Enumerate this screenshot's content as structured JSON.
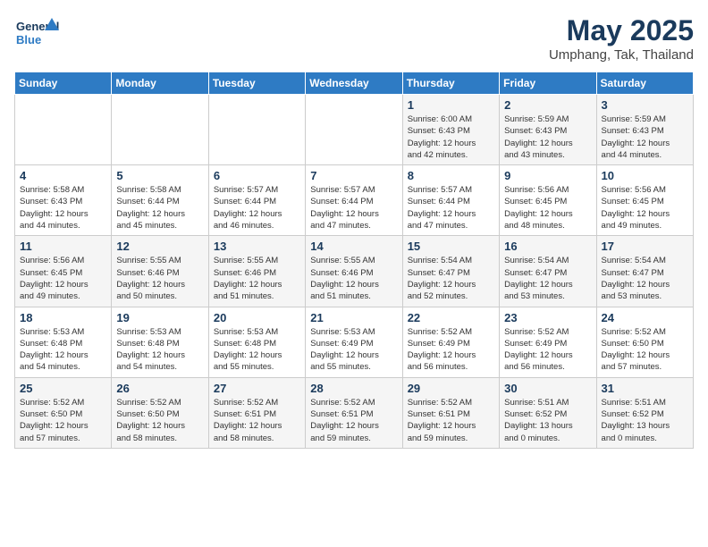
{
  "header": {
    "logo_line1": "General",
    "logo_line2": "Blue",
    "title": "May 2025",
    "subtitle": "Umphang, Tak, Thailand"
  },
  "weekdays": [
    "Sunday",
    "Monday",
    "Tuesday",
    "Wednesday",
    "Thursday",
    "Friday",
    "Saturday"
  ],
  "weeks": [
    [
      {
        "day": "",
        "info": ""
      },
      {
        "day": "",
        "info": ""
      },
      {
        "day": "",
        "info": ""
      },
      {
        "day": "",
        "info": ""
      },
      {
        "day": "1",
        "info": "Sunrise: 6:00 AM\nSunset: 6:43 PM\nDaylight: 12 hours\nand 42 minutes."
      },
      {
        "day": "2",
        "info": "Sunrise: 5:59 AM\nSunset: 6:43 PM\nDaylight: 12 hours\nand 43 minutes."
      },
      {
        "day": "3",
        "info": "Sunrise: 5:59 AM\nSunset: 6:43 PM\nDaylight: 12 hours\nand 44 minutes."
      }
    ],
    [
      {
        "day": "4",
        "info": "Sunrise: 5:58 AM\nSunset: 6:43 PM\nDaylight: 12 hours\nand 44 minutes."
      },
      {
        "day": "5",
        "info": "Sunrise: 5:58 AM\nSunset: 6:44 PM\nDaylight: 12 hours\nand 45 minutes."
      },
      {
        "day": "6",
        "info": "Sunrise: 5:57 AM\nSunset: 6:44 PM\nDaylight: 12 hours\nand 46 minutes."
      },
      {
        "day": "7",
        "info": "Sunrise: 5:57 AM\nSunset: 6:44 PM\nDaylight: 12 hours\nand 47 minutes."
      },
      {
        "day": "8",
        "info": "Sunrise: 5:57 AM\nSunset: 6:44 PM\nDaylight: 12 hours\nand 47 minutes."
      },
      {
        "day": "9",
        "info": "Sunrise: 5:56 AM\nSunset: 6:45 PM\nDaylight: 12 hours\nand 48 minutes."
      },
      {
        "day": "10",
        "info": "Sunrise: 5:56 AM\nSunset: 6:45 PM\nDaylight: 12 hours\nand 49 minutes."
      }
    ],
    [
      {
        "day": "11",
        "info": "Sunrise: 5:56 AM\nSunset: 6:45 PM\nDaylight: 12 hours\nand 49 minutes."
      },
      {
        "day": "12",
        "info": "Sunrise: 5:55 AM\nSunset: 6:46 PM\nDaylight: 12 hours\nand 50 minutes."
      },
      {
        "day": "13",
        "info": "Sunrise: 5:55 AM\nSunset: 6:46 PM\nDaylight: 12 hours\nand 51 minutes."
      },
      {
        "day": "14",
        "info": "Sunrise: 5:55 AM\nSunset: 6:46 PM\nDaylight: 12 hours\nand 51 minutes."
      },
      {
        "day": "15",
        "info": "Sunrise: 5:54 AM\nSunset: 6:47 PM\nDaylight: 12 hours\nand 52 minutes."
      },
      {
        "day": "16",
        "info": "Sunrise: 5:54 AM\nSunset: 6:47 PM\nDaylight: 12 hours\nand 53 minutes."
      },
      {
        "day": "17",
        "info": "Sunrise: 5:54 AM\nSunset: 6:47 PM\nDaylight: 12 hours\nand 53 minutes."
      }
    ],
    [
      {
        "day": "18",
        "info": "Sunrise: 5:53 AM\nSunset: 6:48 PM\nDaylight: 12 hours\nand 54 minutes."
      },
      {
        "day": "19",
        "info": "Sunrise: 5:53 AM\nSunset: 6:48 PM\nDaylight: 12 hours\nand 54 minutes."
      },
      {
        "day": "20",
        "info": "Sunrise: 5:53 AM\nSunset: 6:48 PM\nDaylight: 12 hours\nand 55 minutes."
      },
      {
        "day": "21",
        "info": "Sunrise: 5:53 AM\nSunset: 6:49 PM\nDaylight: 12 hours\nand 55 minutes."
      },
      {
        "day": "22",
        "info": "Sunrise: 5:52 AM\nSunset: 6:49 PM\nDaylight: 12 hours\nand 56 minutes."
      },
      {
        "day": "23",
        "info": "Sunrise: 5:52 AM\nSunset: 6:49 PM\nDaylight: 12 hours\nand 56 minutes."
      },
      {
        "day": "24",
        "info": "Sunrise: 5:52 AM\nSunset: 6:50 PM\nDaylight: 12 hours\nand 57 minutes."
      }
    ],
    [
      {
        "day": "25",
        "info": "Sunrise: 5:52 AM\nSunset: 6:50 PM\nDaylight: 12 hours\nand 57 minutes."
      },
      {
        "day": "26",
        "info": "Sunrise: 5:52 AM\nSunset: 6:50 PM\nDaylight: 12 hours\nand 58 minutes."
      },
      {
        "day": "27",
        "info": "Sunrise: 5:52 AM\nSunset: 6:51 PM\nDaylight: 12 hours\nand 58 minutes."
      },
      {
        "day": "28",
        "info": "Sunrise: 5:52 AM\nSunset: 6:51 PM\nDaylight: 12 hours\nand 59 minutes."
      },
      {
        "day": "29",
        "info": "Sunrise: 5:52 AM\nSunset: 6:51 PM\nDaylight: 12 hours\nand 59 minutes."
      },
      {
        "day": "30",
        "info": "Sunrise: 5:51 AM\nSunset: 6:52 PM\nDaylight: 13 hours\nand 0 minutes."
      },
      {
        "day": "31",
        "info": "Sunrise: 5:51 AM\nSunset: 6:52 PM\nDaylight: 13 hours\nand 0 minutes."
      }
    ]
  ]
}
